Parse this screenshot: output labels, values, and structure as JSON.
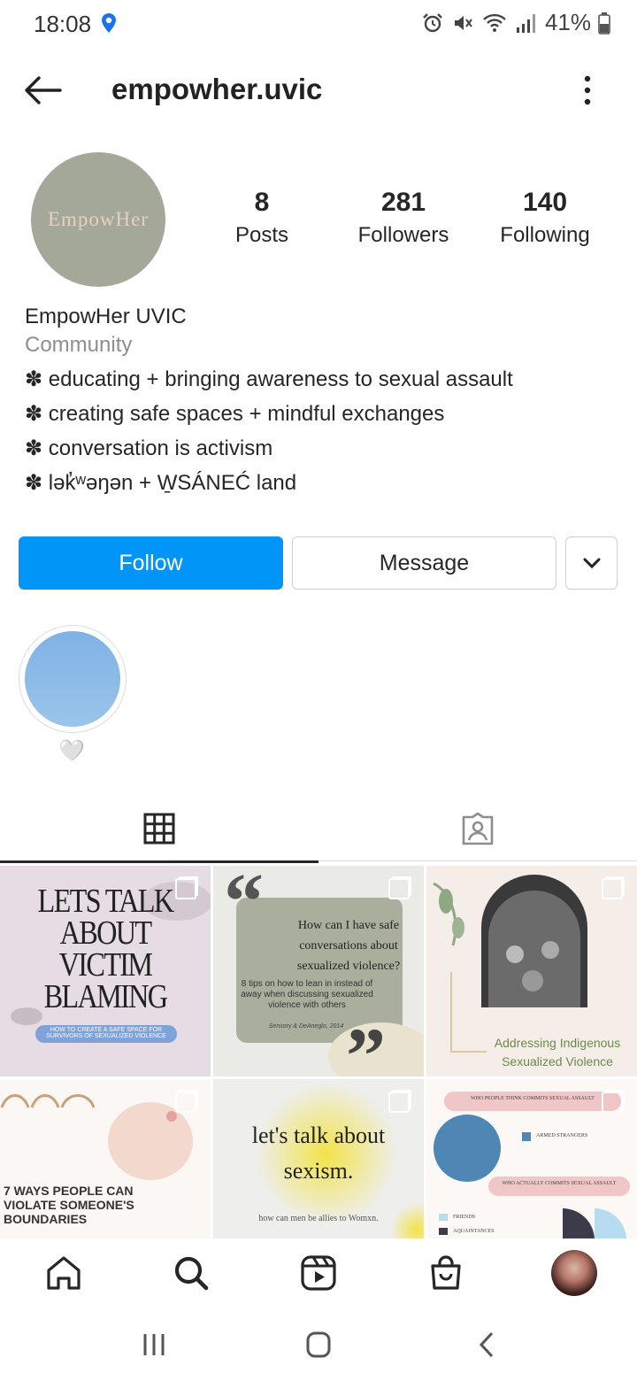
{
  "status_bar": {
    "time": "18:08",
    "battery": "41%"
  },
  "header": {
    "username": "empowher.uvic"
  },
  "profile": {
    "avatar_text": "EmpowHer",
    "stats": [
      {
        "value": "8",
        "label": "Posts"
      },
      {
        "value": "281",
        "label": "Followers"
      },
      {
        "value": "140",
        "label": "Following"
      }
    ],
    "display_name": "EmpowHer UVIC",
    "category": "Community",
    "bio_lines": [
      "✽ educating + bringing awareness to sexual assault",
      "✽ creating safe spaces + mindful exchanges",
      "✽ conversation is activism",
      "✽ lək̓ʷəŋən + W̱SÁNEĆ land"
    ]
  },
  "actions": {
    "follow": "Follow",
    "message": "Message"
  },
  "highlights": [
    {
      "label": "🤍",
      "color": "#8bb9e6"
    }
  ],
  "posts": [
    {
      "title": "LETS TALK ABOUT VICTIM BLAMING",
      "subtitle": "HOW TO CREATE A SAFE SPACE FOR SURVIVORS OF SEXUALIZED VIOLENCE"
    },
    {
      "title": "How can I have safe conversations about sexualized violence?",
      "subtitle": "8 tips on how to lean in instead of away when discussing sexualized violence with others",
      "credit": "Sensory & DeAneglo, 2014"
    },
    {
      "title": "Addressing Indigenous Sexualized Violence"
    },
    {
      "title": "7 WAYS PEOPLE CAN VIOLATE SOMEONE'S BOUNDARIES"
    },
    {
      "title": "let's talk about sexism.",
      "subtitle": "how can men be allies to Womxn."
    },
    {
      "title": "WHO PEOPLE THINK COMMITS SEXUAL ASSAULT",
      "legend1": "ARMED STRANGERS",
      "subtitle": "WHO ACTUALLY COMMITS SEXUAL ASSAULT",
      "legend2": "FRIENDS",
      "legend3": "AQUAINTANCES"
    }
  ],
  "colors": {
    "accent": "#0095f6",
    "text": "#262626",
    "muted": "#8e8e8e"
  }
}
